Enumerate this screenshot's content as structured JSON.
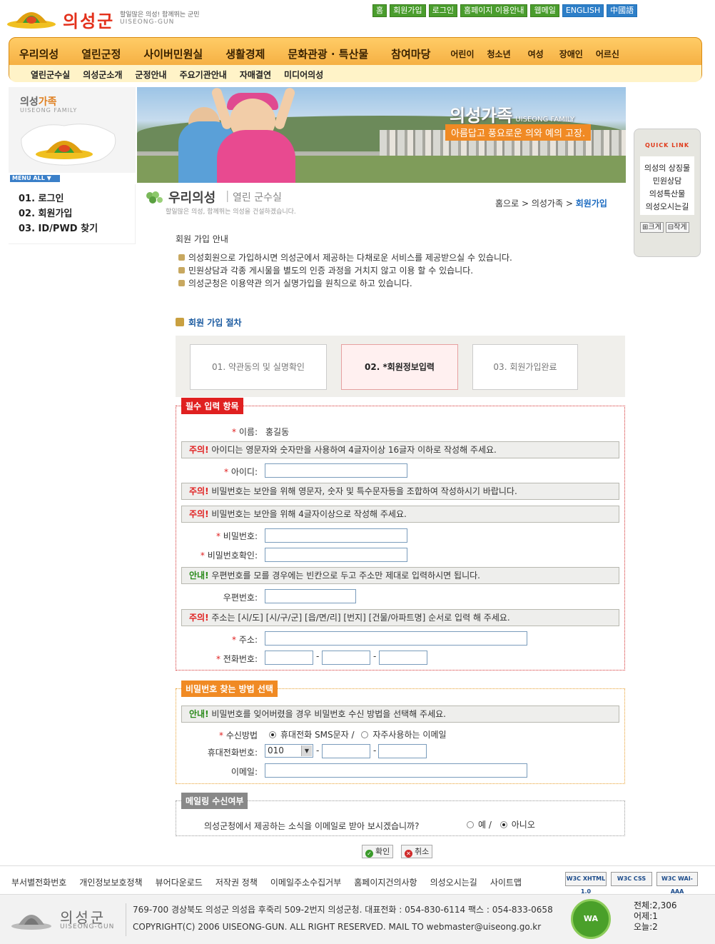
{
  "header": {
    "logo_title": "의성군",
    "logo_slogan": "할일많은 의성! 함께뛰는 군민",
    "logo_sub": "UISEONG-GUN",
    "top_buttons": [
      "홈",
      "회원가입",
      "로그인",
      "홈페이지 이용안내",
      "웹메일",
      "ENGLISH",
      "中國語"
    ]
  },
  "nav": {
    "main": [
      "우리의성",
      "열린군정",
      "사이버민원실",
      "생활경제",
      "문화관광 · 특산물",
      "참여마당"
    ],
    "small": [
      "어린이",
      "청소년",
      "여성",
      "장애인",
      "어르신"
    ],
    "sub": [
      "열린군수실",
      "의성군소개",
      "군정안내",
      "주요기관안내",
      "자매결연",
      "미디어의성"
    ]
  },
  "left": {
    "family_title_a": "의성",
    "family_title_b": "가족",
    "family_sub": "UISEONG FAMILY",
    "menu_all": "MENU ALL ▼",
    "menu": [
      "01. 로그인",
      "02. 회원가입",
      "03. ID/PWD 찾기"
    ]
  },
  "banner": {
    "title": "의성가족",
    "title_sub": "UISEONG FAMILY",
    "slogan": "아름답고 풍요로운 의와 예의 고장."
  },
  "quick": {
    "title": "QUICK LINK",
    "links": [
      "의성의 상징물",
      "민원상담",
      "의성특산물",
      "의성오시는길"
    ],
    "zoom_in": "⊞크게",
    "zoom_out": "⊟작게"
  },
  "page_head": {
    "title": "우리의성",
    "sep": "|",
    "sub": "열린 군수실",
    "desc": "할일많은 의성, 함께뛰는 의성을 건설하겠습니다.",
    "crumb_home": "홈으로",
    "crumb_mid": "의성가족",
    "crumb_current": "회원가입",
    "crumb_sep": ">"
  },
  "guide": {
    "title": "회원 가입 안내",
    "items": [
      "의성회원으로 가입하시면 의성군에서 제공하는 다채로운 서비스를 제공받으실 수 있습니다.",
      "민원상담과 각종 게시물을 별도의 인증 과정을 거치지 않고 이용 할 수 있습니다.",
      "의성군청은 이용약관 의거 실명가입을 원칙으로 하고 있습니다."
    ]
  },
  "procedure": {
    "title": "회원 가입 절차",
    "steps": [
      "01. 약관동의 및 실명확인",
      "02. *회원정보입력",
      "03. 회원가입완료"
    ]
  },
  "required": {
    "label": "필수 입력 항목",
    "name_label": "이름:",
    "name_value": "홍길동",
    "note_id_tag": "주의!",
    "note_id": "아이디는 영문자와 숫자만을 사용하여 4글자이상 16글자 이하로 작성해 주세요.",
    "id_label": "아이디:",
    "note_pw1_tag": "주의!",
    "note_pw1": "비밀번호는 보안을 위해 영문자, 숫자 및 특수문자등을 조합하여 작성하시기 바랍니다.",
    "note_pw2_tag": "주의!",
    "note_pw2": "비밀번호는 보안을 위해 4글자이상으로 작성해 주세요.",
    "pw_label": "비밀번호:",
    "pw_confirm_label": "비밀번호확인:",
    "note_zip_tag": "안내!",
    "note_zip": "우편번호를 모를 경우에는 빈칸으로 두고 주소만 제대로 입력하시면 됩니다.",
    "zip_label": "우편번호:",
    "note_addr_tag": "주의!",
    "note_addr": "주소는 [시/도] [시/구/군] [읍/면/리] [번지] [건물/아파트명] 순서로 입력 해 주세요.",
    "addr_label": "주소:",
    "phone_label": "전화번호:",
    "dash": "-",
    "star": "*"
  },
  "pwfind": {
    "label": "비밀번호 찾는 방법 선택",
    "note_tag": "안내!",
    "note": "비밀번호를 잊어버렸을 경우 비밀번호 수신 방법을 선택해 주세요.",
    "method_label": "수신방법",
    "opt_sms": "휴대전화 SMS문자 /",
    "opt_email": "자주사용하는 이메일",
    "mobile_label": "휴대전화번호:",
    "mobile_prefix": "010",
    "email_label": "이메일:"
  },
  "mailing": {
    "label": "메일링 수신여부",
    "question": "의성군청에서 제공하는 소식을 이메일로 받아 보시겠습니까?",
    "yes": "예 /",
    "no": "아니오"
  },
  "buttons": {
    "confirm": "확인",
    "cancel": "취소"
  },
  "footer": {
    "links": [
      "부서별전화번호",
      "개인정보보호정책",
      "뷰어다운로드",
      "저작권 정책",
      "이메일주소수집거부",
      "홈페이지건의사항",
      "의성오시는길",
      "사이트맵"
    ],
    "badges": [
      "W3C XHTML 1.0",
      "W3C CSS",
      "W3C WAI-AAA"
    ],
    "logo_title": "의성군",
    "logo_sub": "UISEONG-GUN",
    "address": "769-700 경상북도 의성군 의성읍 후죽리 509-2번지 의성군청. 대표전화 : 054-830-6114 팩스 : 054-833-0658",
    "copyright": "COPYRIGHT(C) 2006 UISEONG-GUN. ALL RIGHT RESERVED. MAIL TO webmaster@uiseong.go.kr",
    "wa_mark": "WA",
    "stats": [
      "전체:2,306",
      "어제:1",
      "오늘:2"
    ]
  },
  "colors": {
    "accent_orange": "#f0a030",
    "required_red": "#e02020",
    "link_blue": "#1a6ac0"
  }
}
